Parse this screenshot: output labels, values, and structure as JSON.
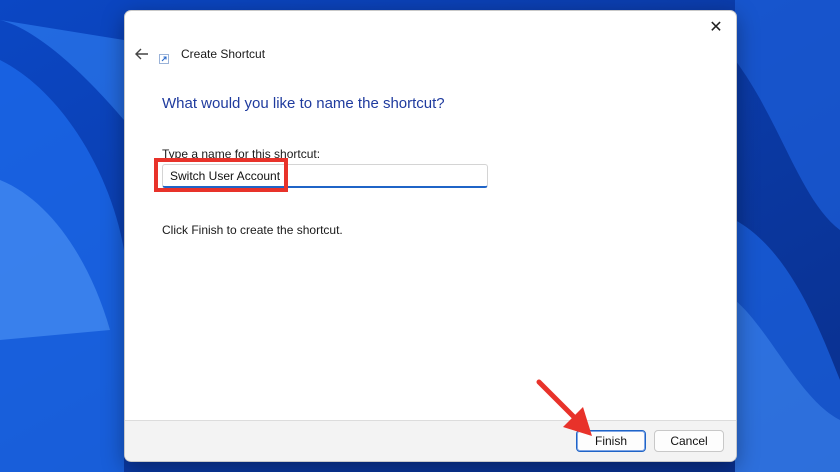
{
  "dialog": {
    "title": "Create Shortcut",
    "heading": "What would you like to name the shortcut?",
    "field_label": "Type a name for this shortcut:",
    "name_value": "Switch User Account",
    "instruction": "Click Finish to create the shortcut.",
    "close_glyph": "✕",
    "back_icon": "back-arrow-icon",
    "title_icon": "shortcut-icon"
  },
  "footer": {
    "finish_label": "Finish",
    "cancel_label": "Cancel"
  },
  "annotations": {
    "highlight_color": "#e8322a",
    "arrow_color": "#e8322a"
  },
  "colors": {
    "heading": "#1f3b9e",
    "accent": "#1f64c7",
    "wallpaper": "#0a3fae"
  }
}
